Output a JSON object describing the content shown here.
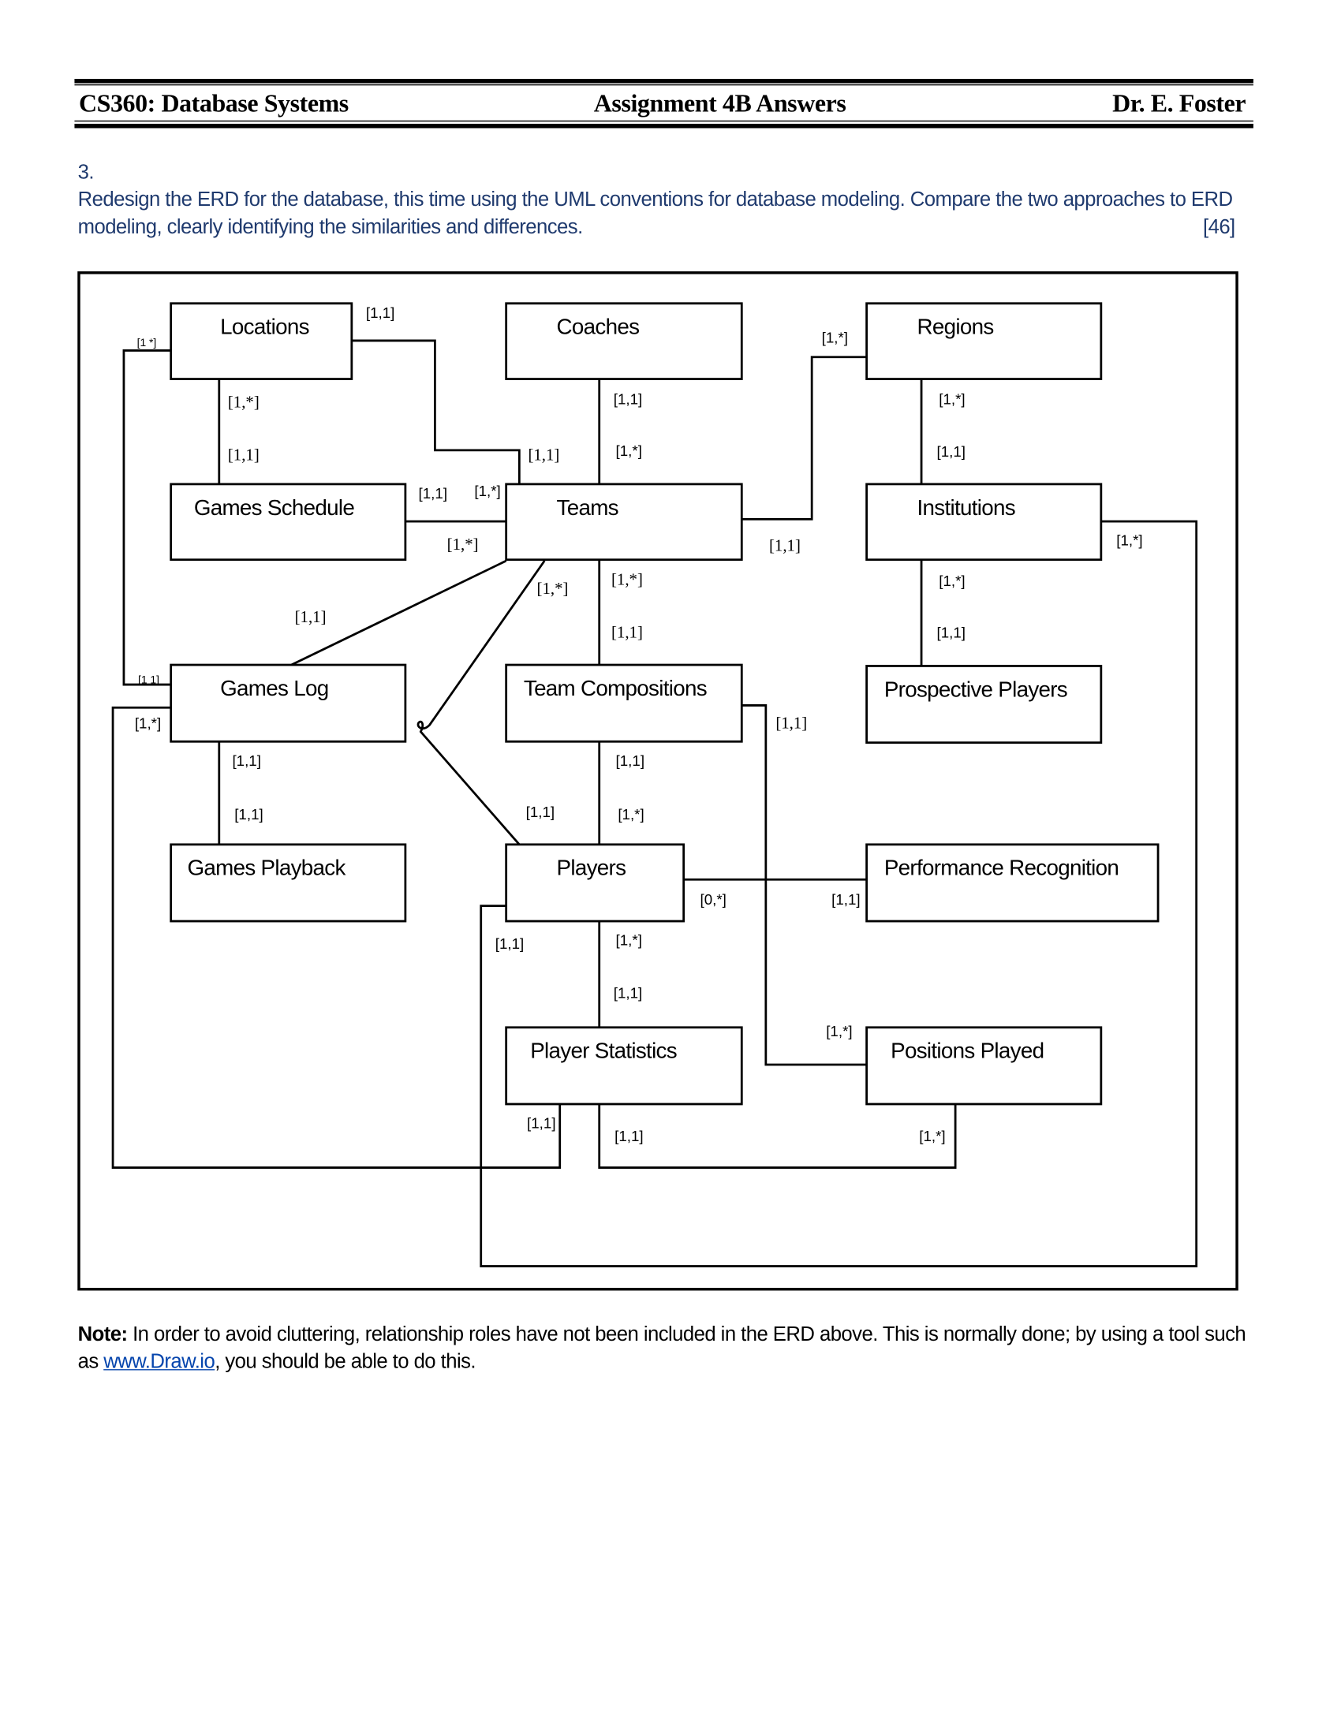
{
  "header": {
    "course": "CS360: Database Systems",
    "assignment": "Assignment 4B Answers",
    "instructor": "Dr. E. Foster"
  },
  "question": {
    "number": "3.",
    "text_line1": "Redesign the ERD for the database, this time using the UML conventions for database modeling. Compare the two approaches to ERD",
    "text_line2": "modeling, clearly identifying the similarities and differences.",
    "marks": "[46]"
  },
  "colors": {
    "question_text": "#1f3a6e",
    "link": "#0645ad"
  },
  "diagram": {
    "entities": [
      "Locations",
      "Coaches",
      "Regions",
      "Games Schedule",
      "Teams",
      "Institutions",
      "Games Log",
      "Team Compositions",
      "Prospective Players",
      "Games Playback",
      "Players",
      "Performance Recognition",
      "Player Statistics",
      "Positions Played"
    ],
    "multiplicities": [
      "[1,1]",
      "[1 *]",
      "[1,*]",
      "[1,1]",
      "[1,1]",
      "[1,*]",
      "[1,*]",
      "[1,*]",
      "[1,1]",
      "[1,1]",
      "[1,1]",
      "[1,*]",
      "[1,*]",
      "[1,1]",
      "[1,*]",
      "[1,*]",
      "[1,*]",
      "[1,1]",
      "[1,*]",
      "[1,1]",
      "[1,1]",
      "[1 1]",
      "[1,*]",
      "[1,1]",
      "[1,1]",
      "[1,1]",
      "[1,1]",
      "[1,*]",
      "[1,1]",
      "[0,*]",
      "[1,1]",
      "[1,1]",
      "[1,*]",
      "[1,1]",
      "[1,*]",
      "[1,1]",
      "[1,1]",
      "[1,*]"
    ]
  },
  "note": {
    "label": "Note:",
    "text_before": " In order to avoid cluttering, relationship roles have not been included in the ERD above. This is normally done; by using a tool such as ",
    "link": "www.Draw.io",
    "text_after": ", you should be able to do this."
  }
}
